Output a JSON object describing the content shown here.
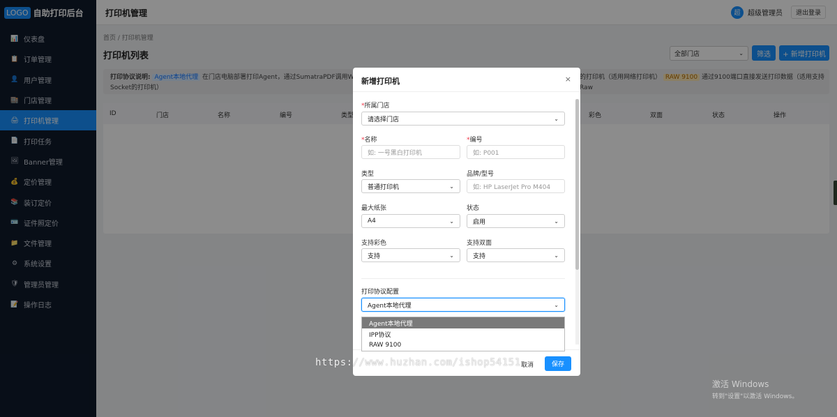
{
  "app": {
    "logo_badge": "LOGO",
    "title": "自助打印后台"
  },
  "sidebar": {
    "items": [
      {
        "label": "仪表盘",
        "icon": "📊"
      },
      {
        "label": "订单管理",
        "icon": "📋"
      },
      {
        "label": "用户管理",
        "icon": "👤"
      },
      {
        "label": "门店管理",
        "icon": "🏬"
      },
      {
        "label": "打印机管理",
        "icon": "🖨"
      },
      {
        "label": "打印任务",
        "icon": "📄"
      },
      {
        "label": "Banner管理",
        "icon": "🖼"
      },
      {
        "label": "定价管理",
        "icon": "💰"
      },
      {
        "label": "装订定价",
        "icon": "📚"
      },
      {
        "label": "证件照定价",
        "icon": "🪪"
      },
      {
        "label": "文件管理",
        "icon": "📁"
      },
      {
        "label": "系统设置",
        "icon": "⚙"
      },
      {
        "label": "管理员管理",
        "icon": "🛡"
      },
      {
        "label": "操作日志",
        "icon": "📝"
      }
    ]
  },
  "header": {
    "title": "打印机管理",
    "avatar_text": "超",
    "username": "超级管理员",
    "logout_label": "退出登录"
  },
  "main": {
    "breadcrumb": "首页 / 打印机管理",
    "page_title": "打印机列表",
    "store_filter": "全部门店",
    "filter_label": "筛选",
    "add_label": "+ 新增打印机",
    "notice": {
      "label": "打印协议说明:",
      "agent_tag": "Agent本地代理",
      "text1": "在门店电脑部署打印Agent，通过SumatraPDF调用Windows打印",
      "text2": "的打印机（适用网络打印机）",
      "raw_tag": "RAW 9100",
      "text3": "通过9100端口直接发送打印数据（适用支持Raw",
      "text4": "Socket的打印机）"
    },
    "table_headers": [
      "ID",
      "门店",
      "名称",
      "编号",
      "类型",
      "彩色",
      "双面",
      "状态",
      "操作"
    ]
  },
  "modal": {
    "title": "新增打印机",
    "close": "×",
    "store": {
      "label": "所属门店",
      "value": "请选择门店"
    },
    "name": {
      "label": "名称",
      "placeholder": "如: 一号黑白打印机"
    },
    "code": {
      "label": "编号",
      "placeholder": "如: P001"
    },
    "type": {
      "label": "类型",
      "value": "普通打印机"
    },
    "model": {
      "label": "品牌/型号",
      "placeholder": "如: HP LaserJet Pro M404"
    },
    "paper": {
      "label": "最大纸张",
      "value": "A4"
    },
    "status": {
      "label": "状态",
      "value": "启用"
    },
    "color": {
      "label": "支持彩色",
      "value": "支持"
    },
    "duplex": {
      "label": "支持双面",
      "value": "支持"
    },
    "protocol": {
      "section": "打印协议配置",
      "value": "Agent本地代理",
      "options": [
        "Agent本地代理",
        "IPP协议",
        "RAW 9100"
      ]
    },
    "cancel_label": "取消",
    "save_label": "保存"
  },
  "watermark": "https://www.huzhan.com/ishop54151",
  "windows": {
    "line1": "激活 Windows",
    "line2": "转到\"设置\"以激活 Windows。"
  }
}
